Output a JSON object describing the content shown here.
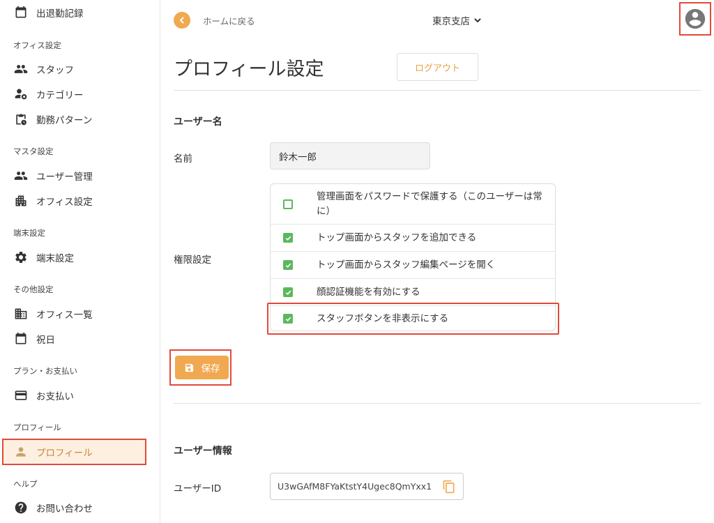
{
  "sidebar": {
    "items": [
      {
        "label": "出退勤記録"
      },
      {
        "label": "スタッフ"
      },
      {
        "label": "カテゴリー"
      },
      {
        "label": "勤務パターン"
      },
      {
        "label": "ユーザー管理"
      },
      {
        "label": "オフィス設定"
      },
      {
        "label": "端末設定"
      },
      {
        "label": "オフィス一覧"
      },
      {
        "label": "祝日"
      },
      {
        "label": "お支払い"
      },
      {
        "label": "プロフィール"
      },
      {
        "label": "お問い合わせ"
      }
    ],
    "sections": [
      "オフィス設定",
      "マスタ設定",
      "端末設定",
      "その他設定",
      "プラン・お支払い",
      "プロフィール",
      "ヘルプ"
    ]
  },
  "topbar": {
    "back_label": "ホームに戻る",
    "branch": "東京支店"
  },
  "profile": {
    "title": "プロフィール設定",
    "logout": "ログアウト",
    "username_heading": "ユーザー名",
    "name_label": "名前",
    "name_value": "鈴木一郎",
    "permissions_label": "権限設定",
    "permissions": [
      {
        "label": "管理画面をパスワードで保護する（このユーザーは常に）",
        "checked": false
      },
      {
        "label": "トップ画面からスタッフを追加できる",
        "checked": true
      },
      {
        "label": "トップ画面からスタッフ編集ページを開く",
        "checked": true
      },
      {
        "label": "顔認証機能を有効にする",
        "checked": true
      },
      {
        "label": "スタッフボタンを非表示にする",
        "checked": true
      }
    ],
    "save": "保存",
    "user_info_heading": "ユーザー情報",
    "user_id_label": "ユーザーID",
    "user_id_value": "U3wGAfM8FYaKtstY4Ugec8QmYxx1"
  },
  "colors": {
    "accent": "#f0a950",
    "highlight": "#e04a3a",
    "check": "#5cb85c"
  }
}
